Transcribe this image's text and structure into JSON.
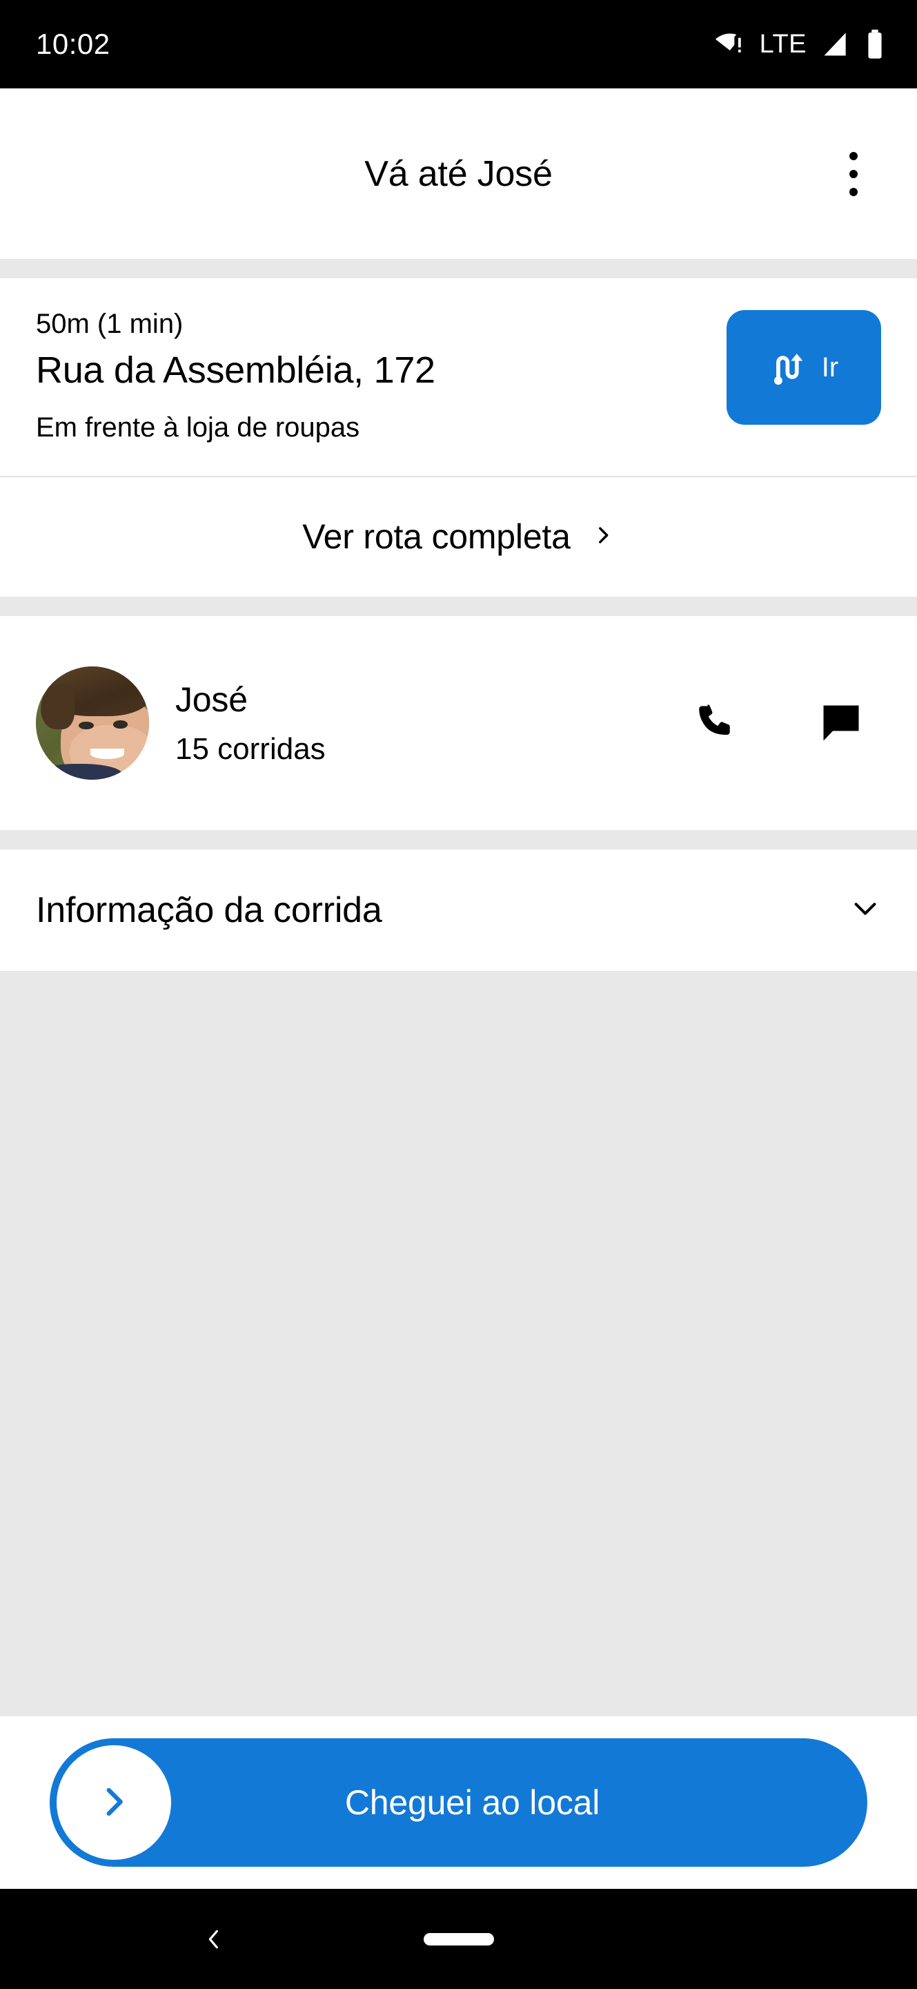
{
  "status_bar": {
    "time": "10:02",
    "network_label": "LTE",
    "icons": [
      "wifi-warning-icon",
      "lte-label",
      "cellular-signal-icon",
      "battery-icon"
    ]
  },
  "app_bar": {
    "title": "Vá até José",
    "overflow_icon": "more-vertical-icon"
  },
  "address_card": {
    "eta": "50m (1 min)",
    "street": "Rua da Assembléia, 172",
    "hint": "Em frente à loja de roupas",
    "go_button": {
      "label": "Ir",
      "icon": "route-navigate-icon",
      "color": "#1379d6"
    }
  },
  "route_link": {
    "label": "Ver rota completa",
    "icon": "chevron-right-icon"
  },
  "passenger": {
    "name": "José",
    "rides": "15 corridas",
    "avatar_icon": "user-avatar-photo",
    "actions": [
      {
        "name": "call",
        "icon": "phone-icon"
      },
      {
        "name": "message",
        "icon": "chat-bubble-icon"
      }
    ]
  },
  "ride_info": {
    "label": "Informação da corrida",
    "icon": "chevron-down-icon",
    "expanded": false
  },
  "cta": {
    "label": "Cheguei ao local",
    "knob_icon": "chevron-right-icon",
    "color": "#1379d6"
  },
  "nav_bar": {
    "back_icon": "chevron-left-icon",
    "home_icon": "home-pill-icon"
  },
  "colors": {
    "accent": "#1379d6",
    "surface": "#ffffff",
    "background": "#e8e8e8",
    "text": "#000000",
    "divider": "#e4e4e4"
  }
}
